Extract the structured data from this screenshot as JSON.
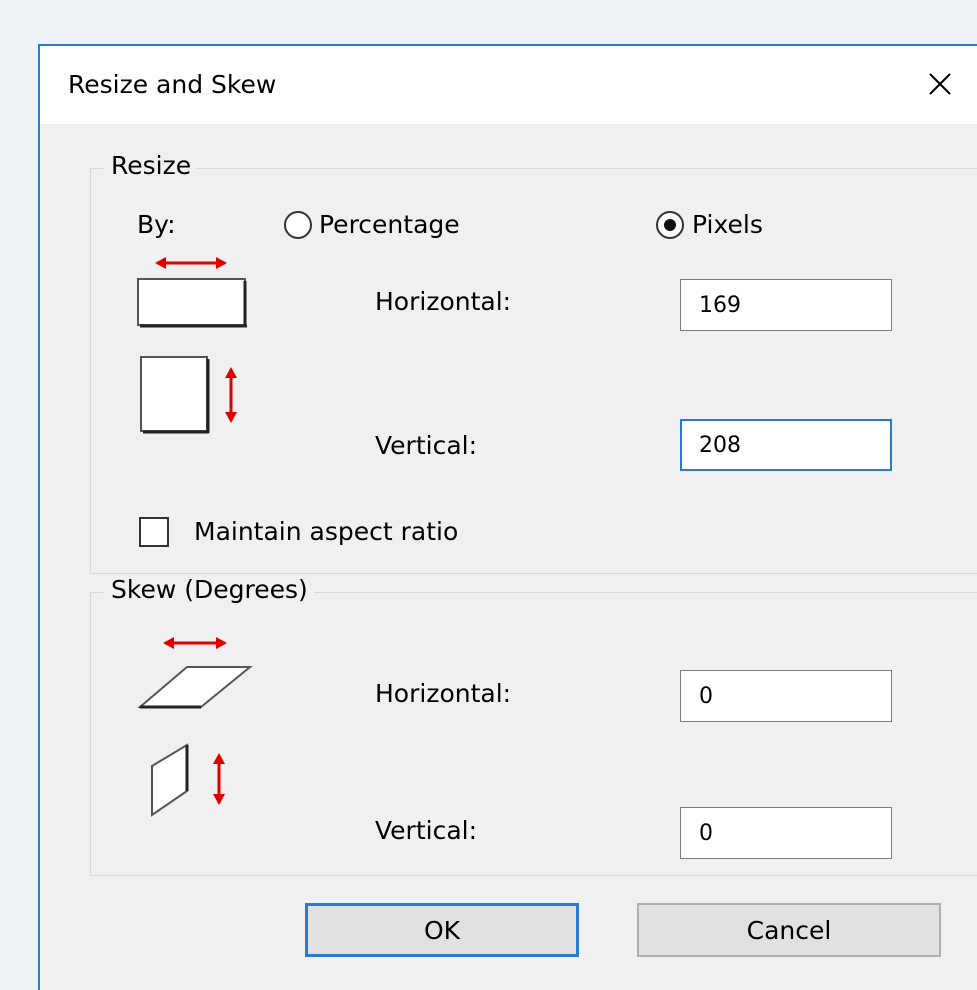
{
  "dialog": {
    "title": "Resize and Skew",
    "close_icon": "close-icon"
  },
  "resize": {
    "legend": "Resize",
    "by_label": "By:",
    "percentage_label": "Percentage",
    "pixels_label": "Pixels",
    "selected_mode": "Pixels",
    "horizontal_label": "Horizontal:",
    "horizontal_value": "169",
    "vertical_label": "Vertical:",
    "vertical_value": "208",
    "maintain_label": "Maintain aspect ratio",
    "maintain_checked": false
  },
  "skew": {
    "legend": "Skew (Degrees)",
    "horizontal_label": "Horizontal:",
    "horizontal_value": "0",
    "vertical_label": "Vertical:",
    "vertical_value": "0"
  },
  "buttons": {
    "ok_label": "OK",
    "cancel_label": "Cancel"
  },
  "colors": {
    "accent": "#2b79d0",
    "arrow": "#e00000"
  }
}
